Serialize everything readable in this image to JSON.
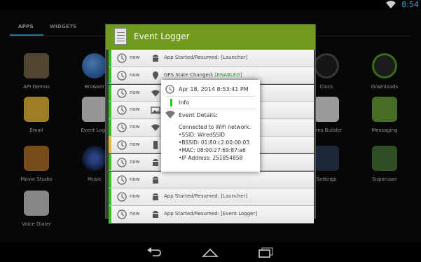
{
  "status_bar": {
    "time": "8:54",
    "wifi_icon": "wifi-icon"
  },
  "launcher": {
    "tabs": [
      {
        "label": "APPS"
      },
      {
        "label": "WIDGETS"
      }
    ],
    "apps": [
      {
        "label": "API Demos"
      },
      {
        "label": "Browser"
      },
      {
        "label": "Clock"
      },
      {
        "label": "Downloads"
      },
      {
        "label": "Email"
      },
      {
        "label": "Event Logg"
      },
      {
        "label": "tures Builder"
      },
      {
        "label": "Messaging"
      },
      {
        "label": "Movie Studio"
      },
      {
        "label": "Music"
      },
      {
        "label": "Settings"
      },
      {
        "label": "Superuser"
      },
      {
        "label": "Voice Dialer"
      }
    ]
  },
  "dialog": {
    "title": "Event Logger",
    "header_color": "#6f9a1c",
    "rows": [
      {
        "when": "now",
        "icon": "android-icon",
        "message": "App Started/Resumed: [Launcher]",
        "level": "info"
      },
      {
        "when": "now",
        "icon": "location-pin-icon",
        "message_prefix": "GPS State Changed: ",
        "message_highlight": "[ENABLED]",
        "level": "info"
      },
      {
        "when": "now",
        "icon": "wifi-icon",
        "message": "",
        "level": "info"
      },
      {
        "when": "now",
        "icon": "image-icon",
        "message": "",
        "level": "info"
      },
      {
        "when": "now",
        "icon": "wifi-icon",
        "message": "",
        "level": "info"
      },
      {
        "when": "now",
        "icon": "phone-icon",
        "message": "",
        "level": "warn"
      },
      {
        "when": "now",
        "icon": "android-icon",
        "message": "",
        "level": "info"
      },
      {
        "when": "now",
        "icon": "android-icon",
        "message": "",
        "level": "info"
      },
      {
        "when": "now",
        "icon": "android-icon",
        "message": "App Started/Resumed: [Launcher]",
        "level": "info"
      },
      {
        "when": "now",
        "icon": "android-icon",
        "message": "App Started/Resumed: [Event Logger]",
        "level": "info"
      }
    ]
  },
  "popup": {
    "date": "Apr 18, 2014 8:53:41 PM",
    "level": "Info",
    "details_title": "Event Details:",
    "details": [
      "Connected to WiFi network.",
      "•SSID: WiredSSID",
      "•BSSID: 01:80:c2:00:00:03",
      "•MAC: 08:00:27:69:87:a6",
      "•IP Address: 251854858"
    ]
  },
  "navbar": {
    "back": "back-icon",
    "home": "home-icon",
    "recents": "recents-icon"
  }
}
